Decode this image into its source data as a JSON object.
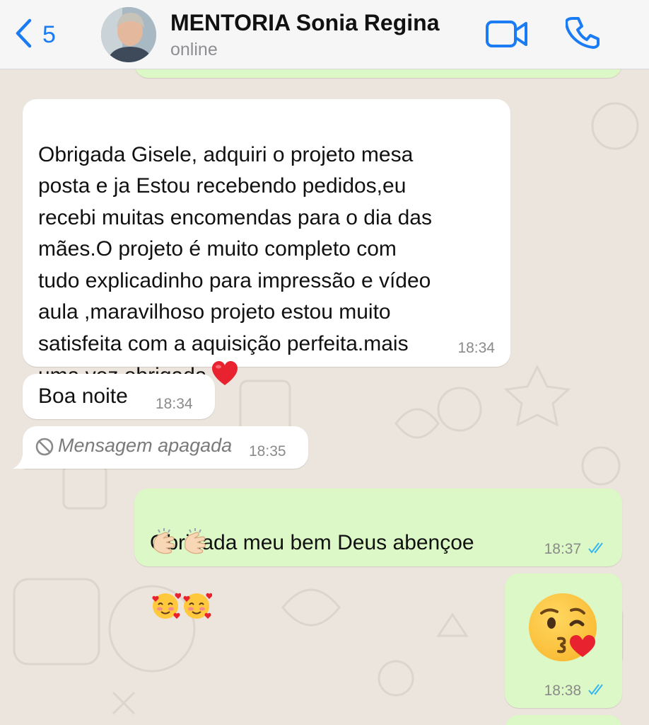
{
  "header": {
    "back_count": "5",
    "contact_name": "MENTORIA Sonia Regina",
    "status": "online"
  },
  "messages": [
    {
      "direction": "incoming",
      "text": "Obrigada Gisele, adquiri o projeto mesa\nposta e ja Estou recebendo pedidos,eu\nrecebi muitas encomendas para o dia das\nmães.O projeto é muito completo com\ntudo explicadinho para impressão e vídeo\naula ,maravilhoso projeto estou muito\nsatisfeita com a aquisição perfeita.mais\numa vez obrigada",
      "emoji": "red-heart",
      "time": "18:34"
    },
    {
      "direction": "incoming",
      "text": "Boa noite",
      "time": "18:34"
    },
    {
      "direction": "incoming",
      "deleted": true,
      "text": "Mensagem apagada",
      "time": "18:35"
    },
    {
      "direction": "outgoing",
      "text": "Obrigada meu bem Deus abençoe",
      "emojis": [
        "smiling-face-with-hearts",
        "smiling-face-with-hearts",
        "clapping-hands",
        "clapping-hands"
      ],
      "time": "18:37",
      "status": "read"
    },
    {
      "direction": "outgoing",
      "emoji_only": "face-blowing-a-kiss",
      "time": "18:38",
      "status": "read"
    }
  ],
  "colors": {
    "accent": "#1A7CF5",
    "outgoing_bubble": "#DCF8C6",
    "incoming_bubble": "#FFFFFF",
    "chat_background": "#ECE5DD",
    "read_tick": "#34B7F1"
  }
}
